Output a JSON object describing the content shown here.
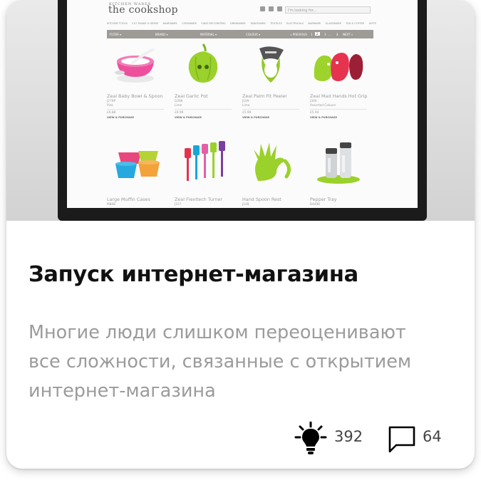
{
  "screenshot": {
    "logo_small": "KITCHEN WARES",
    "logo": "the cookshop",
    "search_placeholder": "I'm looking for...",
    "categories": [
      "KITCHEN TOOLS",
      "CUT SHAKE & SERVE",
      "BAKEWARE",
      "COOKWARE",
      "CAKE DECORATING",
      "DRINKWARE",
      "TABLEWARE",
      "TEXTILES",
      "ELECTRICALS",
      "BARWARE",
      "GLASSWARE",
      "TEA & COFFEE",
      "GIFTS"
    ],
    "filters": {
      "filter": "FILTER ▾",
      "brand": "BRAND ▾",
      "material": "MATERIAL ▾",
      "colour": "COLOUR ▾"
    },
    "pagination": {
      "previous": "« PREVIOUS",
      "pages": [
        "1",
        "2",
        "3",
        "...",
        "4"
      ],
      "active": "2",
      "next": "NEXT »"
    },
    "products": [
      {
        "name": "Zeal Baby Bowl & Spoon",
        "code": "J279P",
        "color": "Pink",
        "price": "£6.88",
        "button": "VIEW & PURCHASE"
      },
      {
        "name": "Zeal Garlic Pot",
        "code": "G266",
        "color": "Lime",
        "price": "£6.99",
        "button": "VIEW & PURCHASE"
      },
      {
        "name": "Zeal Palm Fit Peeler",
        "code": "J109",
        "color": "Lime",
        "price": "£5.99",
        "button": "VIEW & PURCHASE"
      },
      {
        "name": "Zeal Mad Hands Hot Grip",
        "code": "J300",
        "color": "Assorted Colours",
        "price": "£5.94",
        "button": "VIEW & PURCHASE"
      },
      {
        "name": "Large Muffin Cases",
        "code": "M808",
        "color": "",
        "price": "",
        "button": ""
      },
      {
        "name": "Zeal Flexitech Turner",
        "code": "J157",
        "color": "",
        "price": "",
        "button": ""
      },
      {
        "name": "Hand Spoon Rest",
        "code": "J148",
        "color": "",
        "price": "",
        "button": ""
      },
      {
        "name": "Pepper Tray",
        "code": "B4498",
        "color": "",
        "price": "",
        "button": ""
      }
    ]
  },
  "article": {
    "title": "Запуск интернет-магазина",
    "description": "Многие люди слишком переоценивают все сложности, связанные с открытием интернет-магазина",
    "likes": "392",
    "comments": "64"
  },
  "icons": {
    "likes": "lightbulb-icon",
    "comments": "comment-icon"
  }
}
